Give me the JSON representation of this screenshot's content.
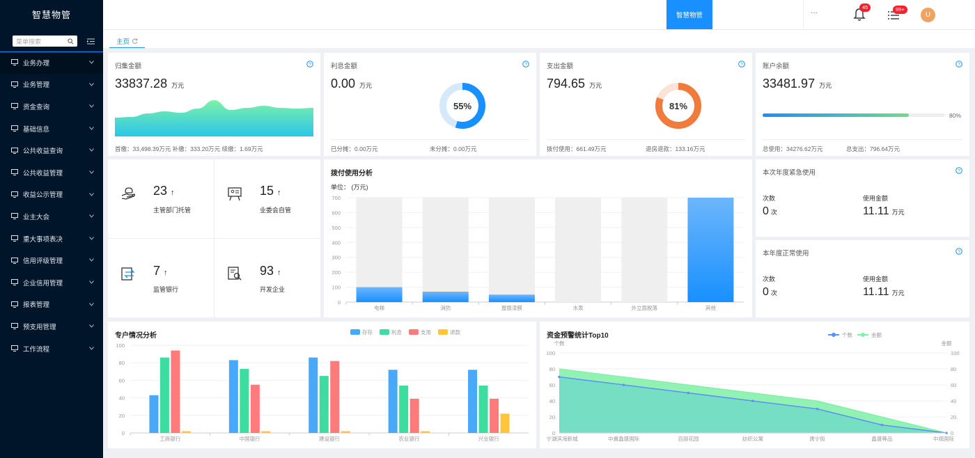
{
  "app": {
    "title": "智慧物管"
  },
  "sidebar": {
    "search_placeholder": "菜单搜索",
    "items": [
      {
        "label": "业务办理"
      },
      {
        "label": "业务管理"
      },
      {
        "label": "资金查询"
      },
      {
        "label": "基础信息"
      },
      {
        "label": "公共收益查询"
      },
      {
        "label": "公共收益管理"
      },
      {
        "label": "收益公示管理"
      },
      {
        "label": "业主大会"
      },
      {
        "label": "重大事项表决"
      },
      {
        "label": "信用评级管理"
      },
      {
        "label": "企业信用管理"
      },
      {
        "label": "报表管理"
      },
      {
        "label": "预支用管理"
      },
      {
        "label": "工作流程"
      }
    ]
  },
  "topbar": {
    "active_tab": "智慧物管",
    "more": "···",
    "notifications_badge": "45",
    "tasks_badge": "99+",
    "avatar_initial": "U"
  },
  "tabs": {
    "home": "主页"
  },
  "cards": {
    "guiji": {
      "title": "归集金额",
      "value": "33837.28",
      "unit": "万元",
      "footer": "首缴：33,498.39万元 补缴：333.20万元 续缴：1.69万元"
    },
    "lixi": {
      "title": "利息金额",
      "value": "0.00",
      "unit": "万元",
      "percent_text": "55%",
      "percent": 55,
      "footer_left": "已分摊：0.00万元",
      "footer_right": "未分摊：0.00万元"
    },
    "zhichu": {
      "title": "支出金额",
      "value": "794.65",
      "unit": "万元",
      "percent_text": "81%",
      "percent": 81,
      "footer_left": "拨付使用：661.49万元",
      "footer_right": "退房退款：133.16万元"
    },
    "zhanghu": {
      "title": "账户余额",
      "value": "33481.97",
      "unit": "万元",
      "progress_text": "80%",
      "progress": 80,
      "footer_left": "总使用：34276.62万元",
      "footer_right": "总支出：796.64万元"
    }
  },
  "stats": [
    {
      "value": "23",
      "label": "主管部门托管",
      "icon": "hand-coin-icon"
    },
    {
      "value": "15",
      "label": "业委会自管",
      "icon": "presentation-icon"
    },
    {
      "value": "7",
      "label": "监管银行",
      "icon": "transfer-icon"
    },
    {
      "value": "93",
      "label": "开发企业",
      "icon": "document-search-icon"
    }
  ],
  "usage": {
    "title": "拨付使用分析",
    "unit_label": "单位：",
    "unit_value": "(万元)"
  },
  "emergency": {
    "title": "本次年度紧急使用",
    "count_label": "次数",
    "amount_label": "使用金额",
    "count": "0",
    "count_unit": "次",
    "amount": "11.11",
    "amount_unit": "万元"
  },
  "normal": {
    "title": "本年度正常使用",
    "count_label": "次数",
    "amount_label": "使用金额",
    "count": "0",
    "count_unit": "次",
    "amount": "11.11",
    "amount_unit": "万元"
  },
  "accounts": {
    "title": "专户情况分析"
  },
  "warning": {
    "title": "资金预警统计Top10"
  },
  "colors": {
    "primary": "#1890ff",
    "sidebar": "#001529",
    "orange": "#ef7c3d",
    "green": "#6fdc8c"
  },
  "chart_data": [
    {
      "type": "area",
      "x": [
        0,
        1,
        2,
        3,
        4,
        5,
        6,
        7,
        8,
        9,
        10,
        11,
        12
      ],
      "values": [
        27,
        28,
        33,
        36,
        34,
        40,
        52,
        38,
        41,
        44,
        41,
        40,
        41
      ],
      "ylim": [
        0,
        60
      ]
    },
    {
      "type": "bar",
      "title": "拨付使用分析",
      "categories": [
        "电梯",
        "消防",
        "屋面漆膜",
        "水泵",
        "外立面脱落",
        "其他"
      ],
      "values": [
        100,
        70,
        50,
        0,
        0,
        700
      ],
      "background_max": 700,
      "ylim": [
        0,
        700
      ],
      "yticks": [
        0,
        100,
        200,
        300,
        400,
        500,
        600,
        700
      ]
    },
    {
      "type": "bar",
      "title": "专户情况分析",
      "categories": [
        "工商银行",
        "中国银行",
        "建设银行",
        "农业银行",
        "兴业银行"
      ],
      "series": [
        {
          "name": "存存",
          "values": [
            43,
            83,
            86,
            72,
            72
          ],
          "color": "#4aa8f8"
        },
        {
          "name": "利息",
          "values": [
            86,
            73,
            65,
            54,
            54
          ],
          "color": "#3ddc9f"
        },
        {
          "name": "支用",
          "values": [
            94,
            55,
            82,
            39,
            39
          ],
          "color": "#ff7a7a"
        },
        {
          "name": "退款",
          "values": [
            2,
            2,
            2,
            2,
            22
          ],
          "color": "#ffc53d"
        }
      ],
      "ylim": [
        0,
        100
      ],
      "yticks": [
        0,
        20,
        40,
        60,
        80,
        100
      ]
    },
    {
      "type": "line",
      "title": "资金预警统计Top10",
      "categories": [
        "宁湖滨海新城",
        "中冀鑫盛国际",
        "百丽花园",
        "纺织公寓",
        "唐宁街",
        "鑫盛尊品",
        "中观国际"
      ],
      "series": [
        {
          "name": "个数",
          "values": [
            70,
            60,
            50,
            40,
            30,
            10,
            0
          ],
          "color": "#5b8ff9"
        },
        {
          "name": "金额",
          "values": [
            80,
            70,
            60,
            50,
            40,
            20,
            0
          ],
          "color": "#7ff0a7"
        }
      ],
      "ylabel_left": "个数",
      "ylabel_right": "金额",
      "ylim": [
        0,
        100
      ],
      "yticks": [
        0,
        20,
        40,
        60,
        80,
        100
      ]
    }
  ]
}
